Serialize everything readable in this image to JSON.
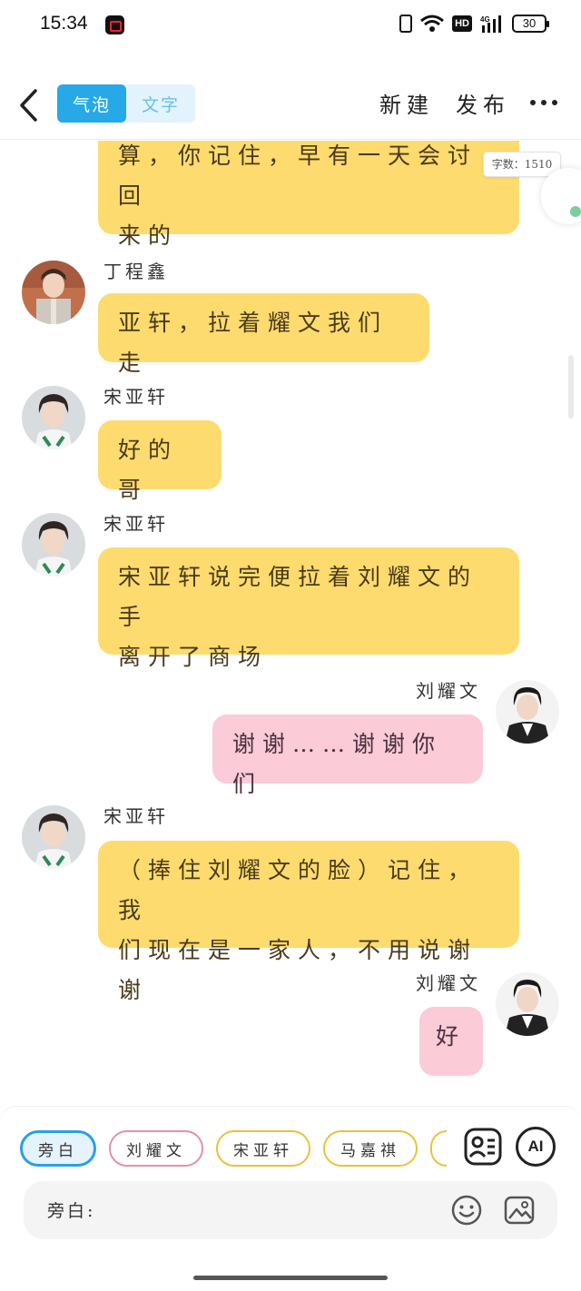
{
  "status_bar": {
    "time": "15:34",
    "network": "4G",
    "hd": "HD",
    "battery": "30"
  },
  "header": {
    "tabs": [
      {
        "label": "气泡",
        "active": true
      },
      {
        "label": "文字",
        "active": false
      }
    ],
    "new_label": "新建",
    "publish_label": "发布"
  },
  "word_count": "字数：1510",
  "messages": [
    {
      "side": "left",
      "name": "",
      "text": "算，你记住，早有一天会讨回\n来的"
    },
    {
      "side": "left",
      "name": "丁程鑫",
      "text": "亚轩，拉着耀文我们走"
    },
    {
      "side": "left",
      "name": "宋亚轩",
      "text": "好的哥"
    },
    {
      "side": "left",
      "name": "宋亚轩",
      "text": "宋亚轩说完便拉着刘耀文的手\n离开了商场"
    },
    {
      "side": "right",
      "name": "刘耀文",
      "text": "谢谢……谢谢你们"
    },
    {
      "side": "left",
      "name": "宋亚轩",
      "text": "（捧住刘耀文的脸）记住，我\n们现在是一家人，不用说谢谢"
    },
    {
      "side": "right",
      "name": "刘耀文",
      "text": "好"
    }
  ],
  "roles": [
    "旁白",
    "刘耀文",
    "宋亚轩",
    "马嘉祺"
  ],
  "input": {
    "prefix": "旁白:",
    "value": ""
  },
  "ai_label": "AI",
  "colors": {
    "accent": "#26a9e6",
    "left_bubble": "#fddb6e",
    "right_bubble": "#fbcbd7"
  }
}
